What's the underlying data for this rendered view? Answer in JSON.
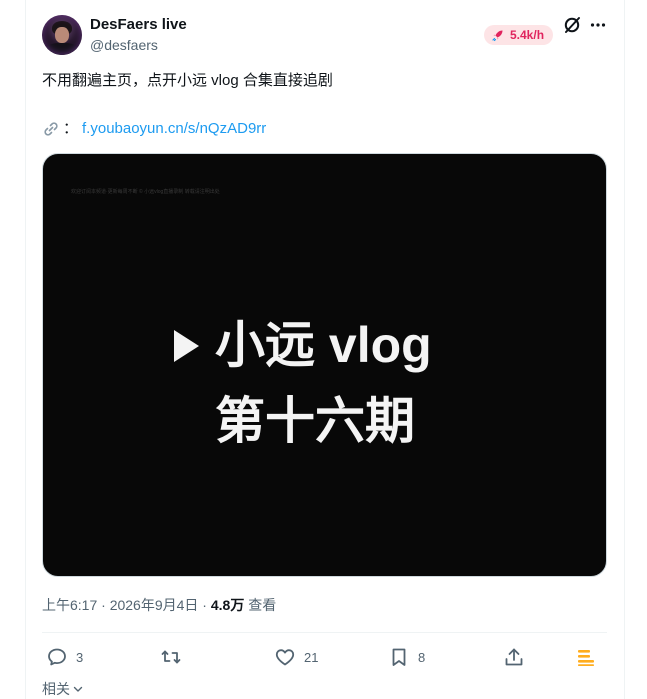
{
  "author": {
    "display_name": "DesFaers live",
    "handle": "@desfaers"
  },
  "header": {
    "rate_badge": "5.4k/h",
    "grok_icon": "grok-icon",
    "more_icon": "more-icon"
  },
  "tweet": {
    "text": "不用翻遍主页，点开小远 vlog 合集直接追剧",
    "link_icon": "link-icon",
    "link_colon": "：",
    "link": "f.youbaoyun.cn/s/nQzAD9rr"
  },
  "media": {
    "caption_small": "欢迎订阅本频道·更新每周不断 © 小远vlog直播录制 转载请注明出处",
    "title_line1": "小远 vlog",
    "title_line2": "第十六期",
    "play_icon": "play-icon"
  },
  "meta": {
    "time": "上午6:17",
    "separator1": " · ",
    "date": "2026年9月4日",
    "separator2": " · ",
    "views_count": "4.8万",
    "views_label": " 查看"
  },
  "actions": {
    "reply_count": "3",
    "retweet_count": "",
    "like_count": "21",
    "bookmark_count": "8"
  },
  "related": {
    "label": "相关"
  },
  "colors": {
    "link": "#1d9bf0",
    "badge_bg": "#fde4e6",
    "badge_text": "#e0245e",
    "accent_yellow": "#ffad1f",
    "muted": "#536471"
  }
}
